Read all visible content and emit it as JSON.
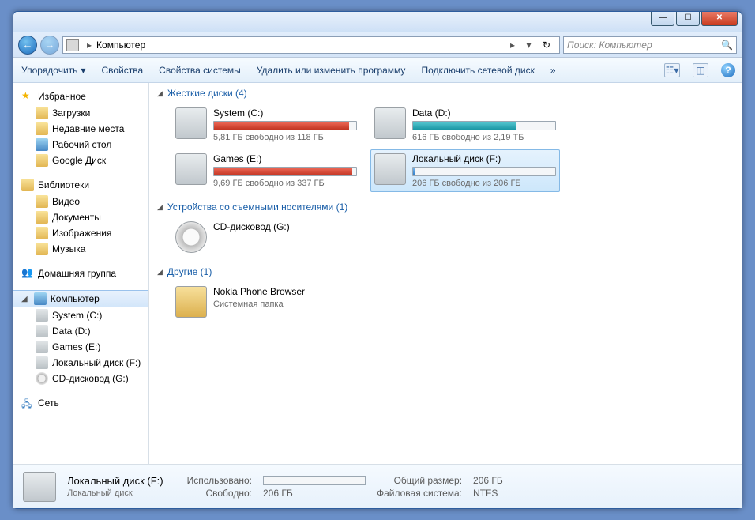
{
  "address": {
    "location": "Компьютер",
    "arrow": "▸"
  },
  "search": {
    "placeholder": "Поиск: Компьютер"
  },
  "toolbar": {
    "organize": "Упорядочить",
    "props": "Свойства",
    "sysprops": "Свойства системы",
    "uninstall": "Удалить или изменить программу",
    "mapdrive": "Подключить сетевой диск",
    "more": "»"
  },
  "sidebar": {
    "favorites": "Избранное",
    "fav_items": [
      "Загрузки",
      "Недавние места",
      "Рабочий стол",
      "Google Диск"
    ],
    "libraries": "Библиотеки",
    "lib_items": [
      "Видео",
      "Документы",
      "Изображения",
      "Музыка"
    ],
    "homegroup": "Домашняя группа",
    "computer": "Компьютер",
    "comp_items": [
      "System (C:)",
      "Data (D:)",
      "Games (E:)",
      "Локальный диск (F:)",
      "CD-дисковод (G:)"
    ],
    "network": "Сеть"
  },
  "sections": {
    "hdd": "Жесткие диски (4)",
    "removable": "Устройства со съемными носителями (1)",
    "other": "Другие (1)"
  },
  "drives": {
    "c": {
      "name": "System (C:)",
      "stat": "5,81 ГБ свободно из 118 ГБ",
      "fill": 95
    },
    "d": {
      "name": "Data (D:)",
      "stat": "616 ГБ свободно из 2,19 ТБ",
      "fill": 72
    },
    "e": {
      "name": "Games (E:)",
      "stat": "9,69 ГБ свободно из 337 ГБ",
      "fill": 97
    },
    "f": {
      "name": "Локальный диск (F:)",
      "stat": "206 ГБ свободно из 206 ГБ",
      "fill": 1
    },
    "g": {
      "name": "CD-дисковод (G:)"
    },
    "nokia": {
      "name": "Nokia Phone Browser",
      "sub": "Системная папка"
    }
  },
  "details": {
    "name": "Локальный диск (F:)",
    "type": "Локальный диск",
    "used_label": "Использовано:",
    "free_label": "Свободно:",
    "free_val": "206 ГБ",
    "total_label": "Общий размер:",
    "total_val": "206 ГБ",
    "fs_label": "Файловая система:",
    "fs_val": "NTFS"
  }
}
